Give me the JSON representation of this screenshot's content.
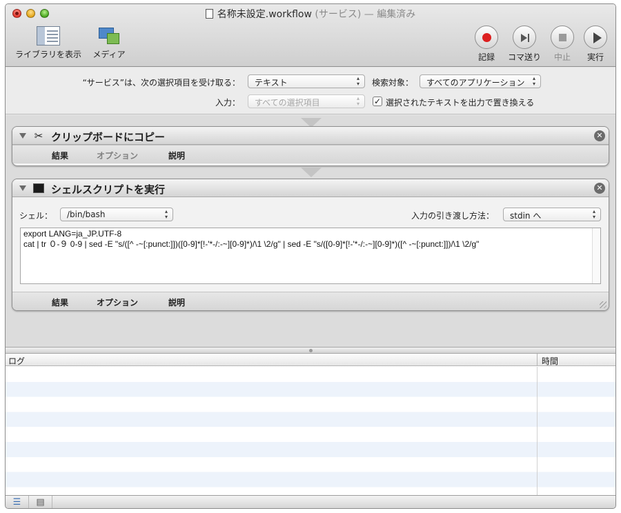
{
  "window": {
    "title_main": "名称未設定.workflow",
    "title_suffix": "(サービス) — 編集済み"
  },
  "toolbar": {
    "library_label": "ライブラリを表示",
    "media_label": "メディア",
    "record_label": "記録",
    "step_label": "コマ送り",
    "stop_label": "中止",
    "run_label": "実行"
  },
  "service": {
    "receives_label": "“サービス”は、次の選択項目を受け取る：",
    "receives_value": "テキスト",
    "search_label": "検索対象：",
    "search_value": "すべてのアプリケーション",
    "input_label": "入力：",
    "input_value": "すべての選択項目",
    "replace_label": "選択されたテキストを出力で置き換える",
    "replace_checked": true
  },
  "actions": [
    {
      "title": "クリップボードにコピー",
      "tabs": [
        "結果",
        "オプション",
        "説明"
      ]
    },
    {
      "title": "シェルスクリプトを実行",
      "shell_label": "シェル：",
      "shell_value": "/bin/bash",
      "pass_label": "入力の引き渡し方法：",
      "pass_value": "stdin へ",
      "script_line1": "export LANG=ja_JP.UTF-8",
      "script_line2": "cat | tr ０-９ 0-9 | sed -E \"s/([^ -~[:punct:]])([0-9]*[!-'*-/:-~][0-9]*)/\\1 \\2/g\" | sed -E \"s/([0-9]*[!-'*-/:-~][0-9]*)([^ -~[:punct:]])/\\1 \\2/g\"",
      "tabs": [
        "結果",
        "オプション",
        "説明"
      ]
    }
  ],
  "log": {
    "col_log": "ログ",
    "col_time": "時間"
  },
  "icons": {
    "record": "record-dot-icon",
    "step": "step-forward-icon",
    "stop": "stop-square-icon",
    "run": "play-icon",
    "library": "library-icon",
    "media": "media-icon",
    "copy": "tools-icon",
    "shell": "terminal-icon"
  }
}
